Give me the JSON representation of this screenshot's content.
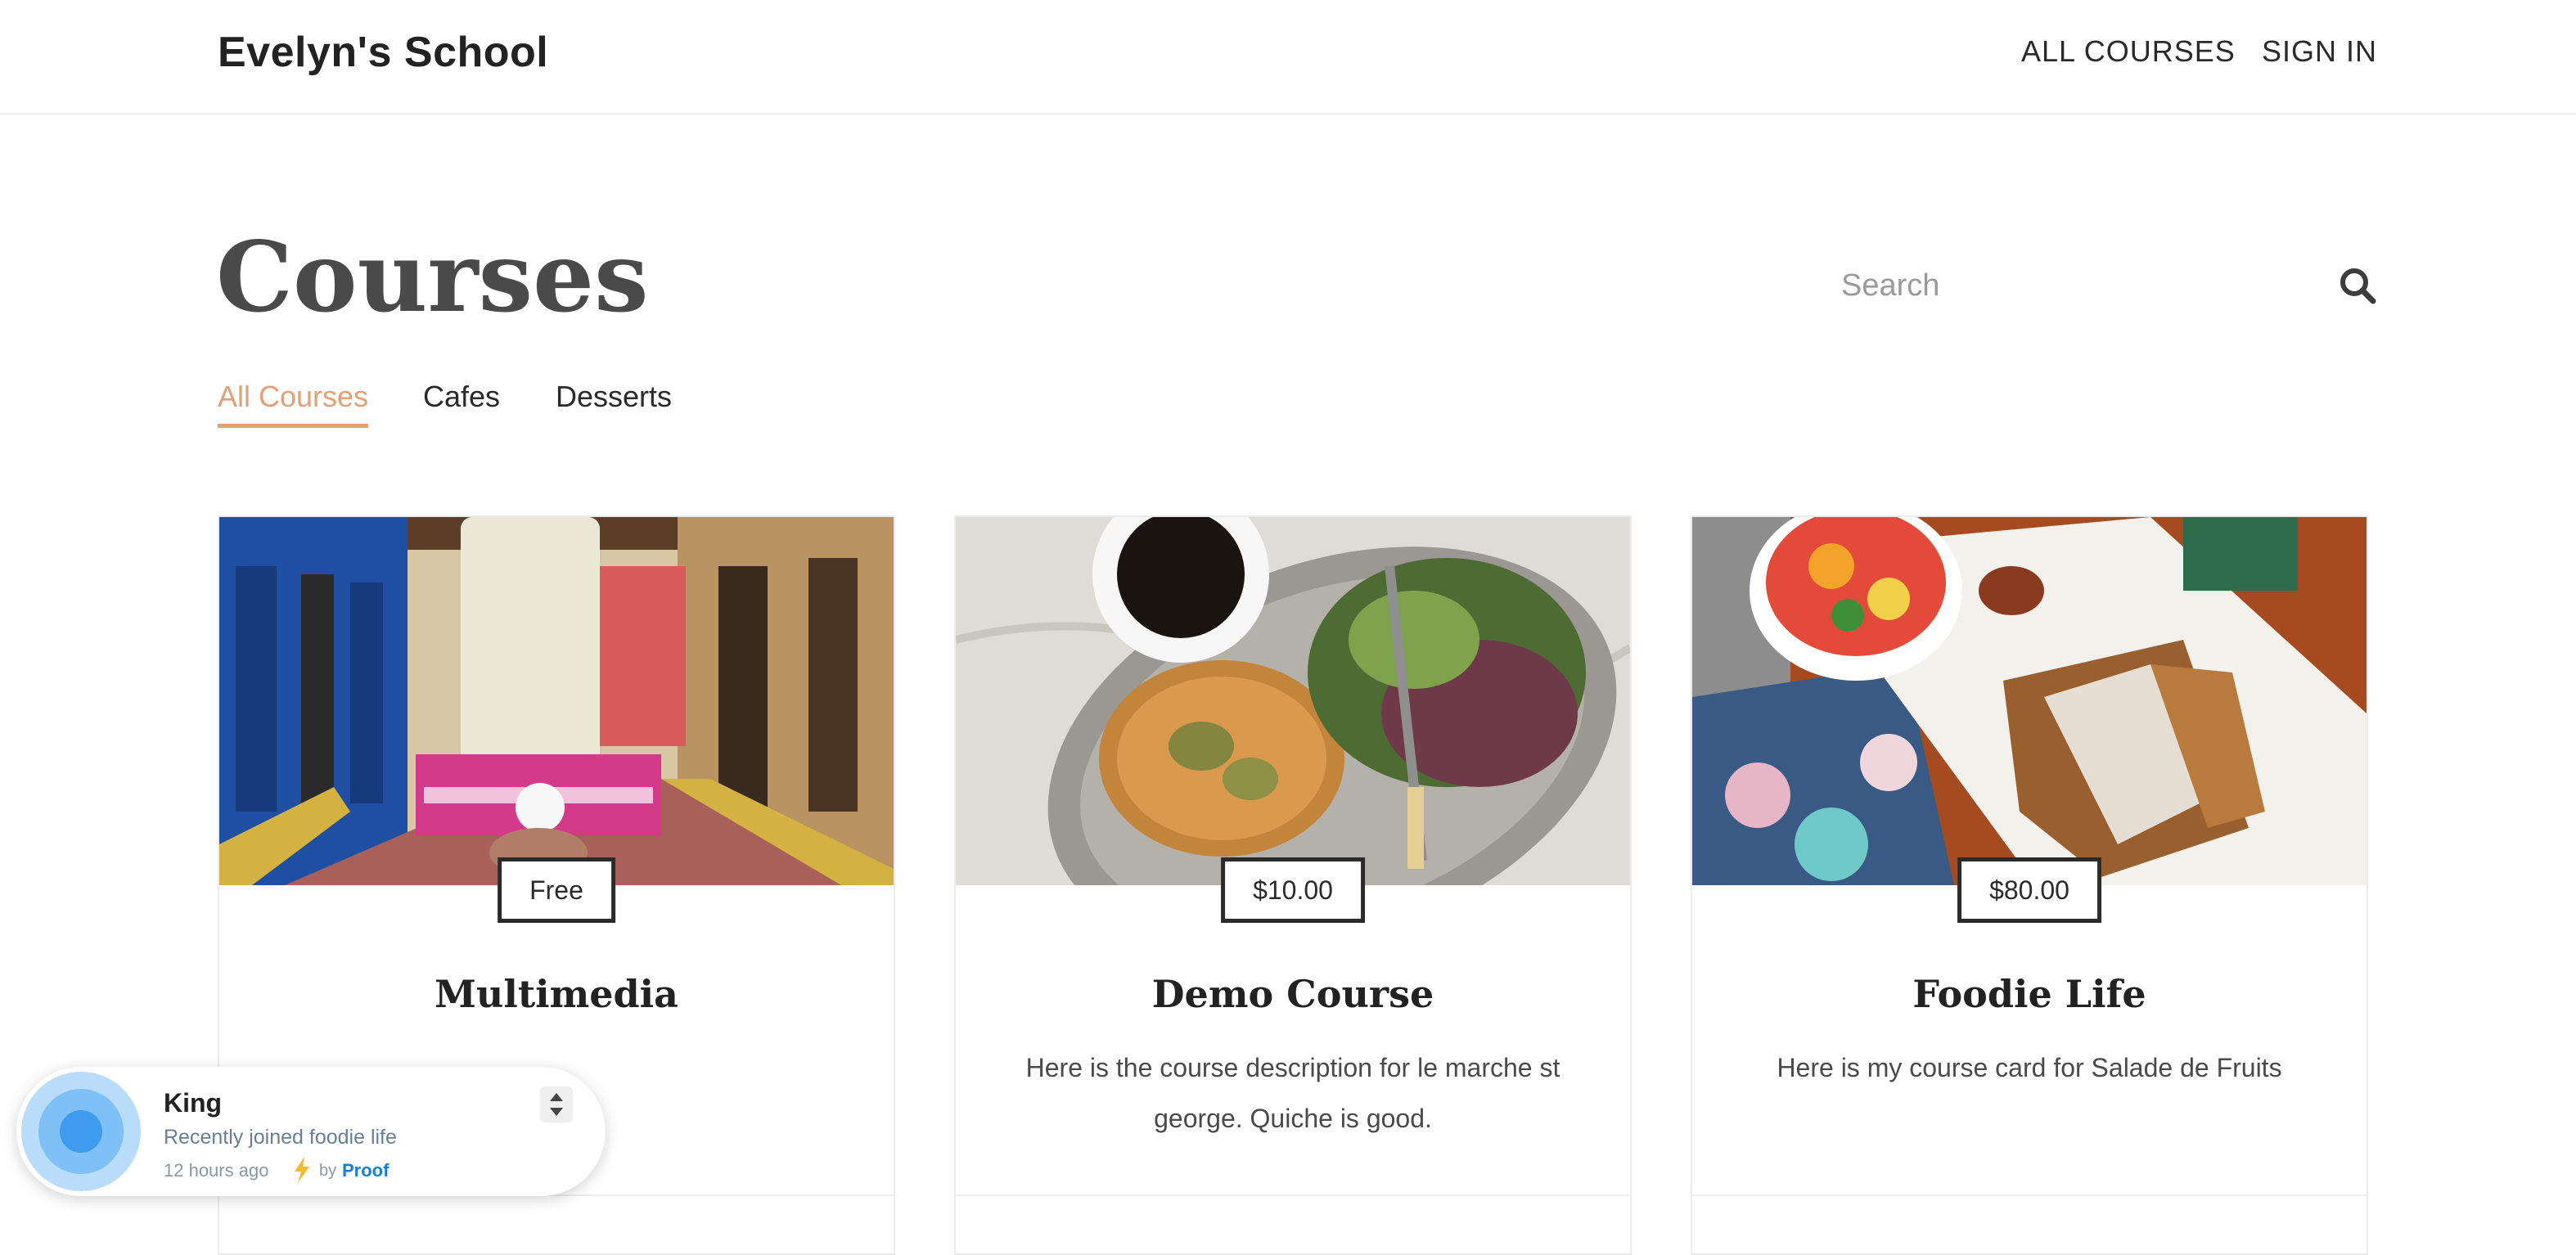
{
  "header": {
    "brand": "Evelyn's School",
    "nav": [
      "ALL COURSES",
      "SIGN IN"
    ]
  },
  "main": {
    "title": "Courses",
    "search": {
      "placeholder": "Search",
      "icon": "search-icon"
    },
    "tabs": [
      {
        "label": "All Courses",
        "active": true
      },
      {
        "label": "Cafes",
        "active": false
      },
      {
        "label": "Desserts",
        "active": false
      }
    ],
    "accent_color": "#e2a079",
    "cards": [
      {
        "price": "Free",
        "title": "Multimedia",
        "description": "",
        "image": "popsicle-photo"
      },
      {
        "price": "$10.00",
        "title": "Demo Course",
        "description": "Here is the course description for le marche st george. Quiche is good.",
        "image": "quiche-photo"
      },
      {
        "price": "$80.00",
        "title": "Foodie Life",
        "description": "Here is my course card for Salade de Fruits",
        "image": "french-toast-photo"
      }
    ]
  },
  "proof_popup": {
    "name": "King",
    "message": "Recently joined foodie life",
    "time": "12 hours ago",
    "by": "by",
    "brand": "Proof",
    "brand_color": "#1a7fd1"
  }
}
